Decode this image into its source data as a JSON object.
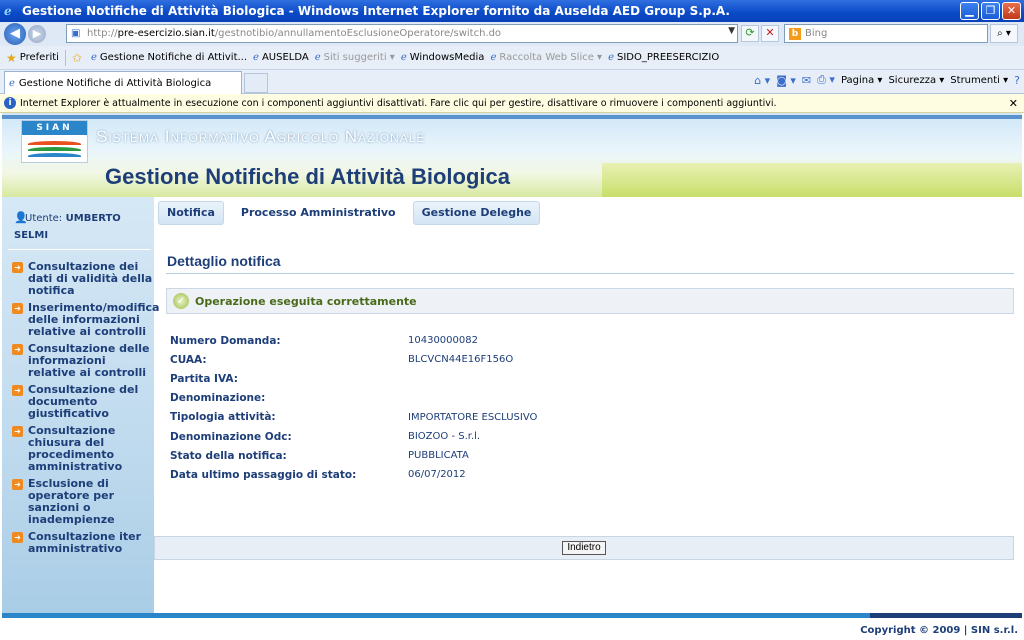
{
  "browser": {
    "title": "Gestione Notifiche di Attività Biologica - Windows Internet Explorer fornito da Auselda AED Group S.p.A.",
    "url_prefix": "http://",
    "url_domain": "pre-esercizio.sian.it",
    "url_path": "/gestnotibio/annullamentoEsclusioneOperatore/switch.do",
    "search_placeholder": "Bing",
    "favorites_label": "Preferiti",
    "favorites": [
      "Gestione Notifiche di Attivit...",
      "AUSELDA",
      "Siti suggeriti ▾",
      "WindowsMedia",
      "Raccolta Web Slice ▾",
      "SIDO_PREESERCIZIO"
    ],
    "tab_title": "Gestione Notifiche di Attività Biologica",
    "commands": {
      "page": "Pagina ▾",
      "security": "Sicurezza ▾",
      "tools": "Strumenti ▾",
      "help": "?"
    },
    "infobar": "Internet Explorer è attualmente in esecuzione con i componenti aggiuntivi disattivati. Fare clic qui per gestire, disattivare o rimuovere i componenti aggiuntivi."
  },
  "header": {
    "logo_text": "SIAN",
    "system_title": "Sistema Informativo Agricolo Nazionale",
    "app_title": "Gestione Notifiche di Attività Biologica"
  },
  "user": {
    "label": "Utente:",
    "name_line1": "UMBERTO",
    "name_line2": "SELMI"
  },
  "sidebar": {
    "items": [
      "Consultazione dei dati di validità della notifica",
      "Inserimento/modifica delle informazioni relative ai controlli",
      "Consultazione delle informazioni relative ai controlli",
      "Consultazione del documento giustificativo",
      "Consultazione chiusura del procedimento amministrativo",
      "Esclusione di operatore per sanzioni o inadempienze",
      "Consultazione iter amministrativo"
    ]
  },
  "menubar": {
    "items": [
      "Notifica",
      "Processo Amministrativo",
      "Gestione Deleghe"
    ]
  },
  "main": {
    "page_title": "Dettaglio notifica",
    "success_message": "Operazione eseguita correttamente",
    "fields": [
      {
        "label": "Numero Domanda:",
        "value": "10430000082"
      },
      {
        "label": "CUAA:",
        "value": "BLCVCN44E16F156O"
      },
      {
        "label": "Partita IVA:",
        "value": ""
      },
      {
        "label": "Denominazione:",
        "value": ""
      },
      {
        "label": "Tipologia attività:",
        "value": "IMPORTATORE ESCLUSIVO"
      },
      {
        "label": "Denominazione Odc:",
        "value": "BIOZOO - S.r.l."
      },
      {
        "label": "Stato della notifica:",
        "value": "PUBBLICATA"
      },
      {
        "label": "Data ultimo passaggio di stato:",
        "value": "06/07/2012"
      }
    ],
    "back_button": "Indietro"
  },
  "footer": {
    "copyright": "Copyright © 2009 | SIN s.r.l."
  }
}
